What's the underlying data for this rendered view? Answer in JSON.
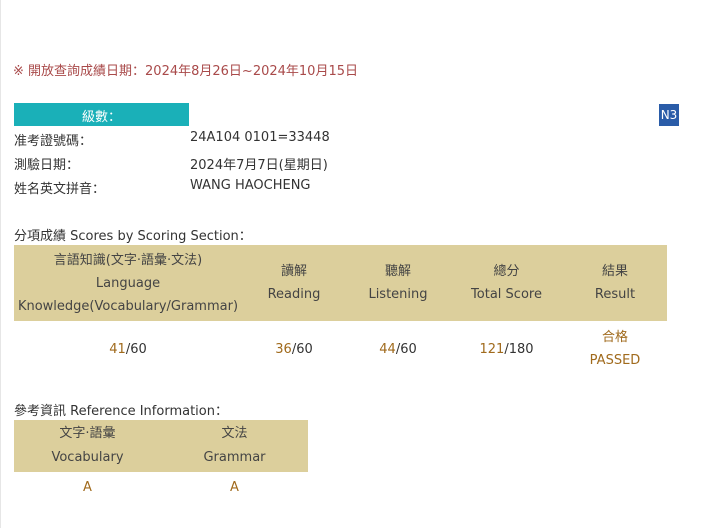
{
  "notice": "※ 開放查詢成績日期：2024年8月26日~2024年10月15日",
  "level": {
    "label": "級數：",
    "value": "N3"
  },
  "info": [
    {
      "label": "准考證號碼：",
      "value": "24A104 0101=33448"
    },
    {
      "label": "測驗日期：",
      "value": "2024年7月7日(星期日)"
    },
    {
      "label": "姓名英文拼音：",
      "value": "WANG HAOCHENG"
    }
  ],
  "scores_title": "分項成績 Scores by Scoring Section：",
  "scores": {
    "headers": [
      {
        "zh": "言語知識(文字‧語彙‧文法)",
        "en1": "Language",
        "en2": "Knowledge(Vocabulary/Grammar)"
      },
      {
        "zh": "讀解",
        "en": "Reading"
      },
      {
        "zh": "聽解",
        "en": "Listening"
      },
      {
        "zh": "總分",
        "en": "Total Score"
      },
      {
        "zh": "結果",
        "en": "Result"
      }
    ],
    "values": [
      {
        "score": "41",
        "max": "/60"
      },
      {
        "score": "36",
        "max": "/60"
      },
      {
        "score": "44",
        "max": "/60"
      },
      {
        "score": "121",
        "max": "/180"
      }
    ],
    "result": {
      "zh": "合格",
      "en": "PASSED"
    }
  },
  "ref_title": "參考資訊 Reference Information：",
  "reference": {
    "headers": [
      {
        "zh": "文字‧語彙",
        "en": "Vocabulary"
      },
      {
        "zh": "文法",
        "en": "Grammar"
      }
    ],
    "values": [
      "A",
      "A"
    ]
  }
}
